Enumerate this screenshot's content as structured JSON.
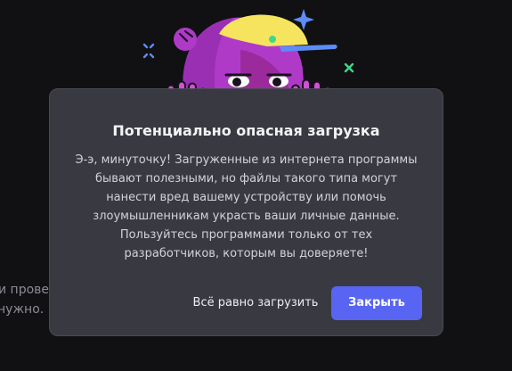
{
  "background": {
    "text_line1": "и прове",
    "text_line2": "нужно."
  },
  "dialog": {
    "title": "Потенциально опасная загрузка",
    "body_lines": [
      "Э-э, минуточку! Загруженные из интернета программы",
      "бывают полезными, но файлы такого типа могут",
      "нанести вред вашему устройству или помочь",
      "злоумышленникам украсть ваши личные данные.",
      "Пользуйтесь программами только от тех",
      "разработчиков, которым вы доверяете!"
    ],
    "secondary_button_label": "Всё равно загрузить",
    "primary_button_label": "Закрыть"
  },
  "colors": {
    "page_bg": "#111114",
    "modal_bg": "#393a41",
    "accent": "#5865f2",
    "character_purple": "#b03ac8",
    "character_yellow": "#f6e45e",
    "sparkle_blue": "#5865f2",
    "sparkle_green": "#4ee58d"
  },
  "illustration": {
    "character": "purple-creature-with-yellow-cap-peeking",
    "icons": [
      "sparkle-icon",
      "plus-icon",
      "star-icon"
    ]
  }
}
